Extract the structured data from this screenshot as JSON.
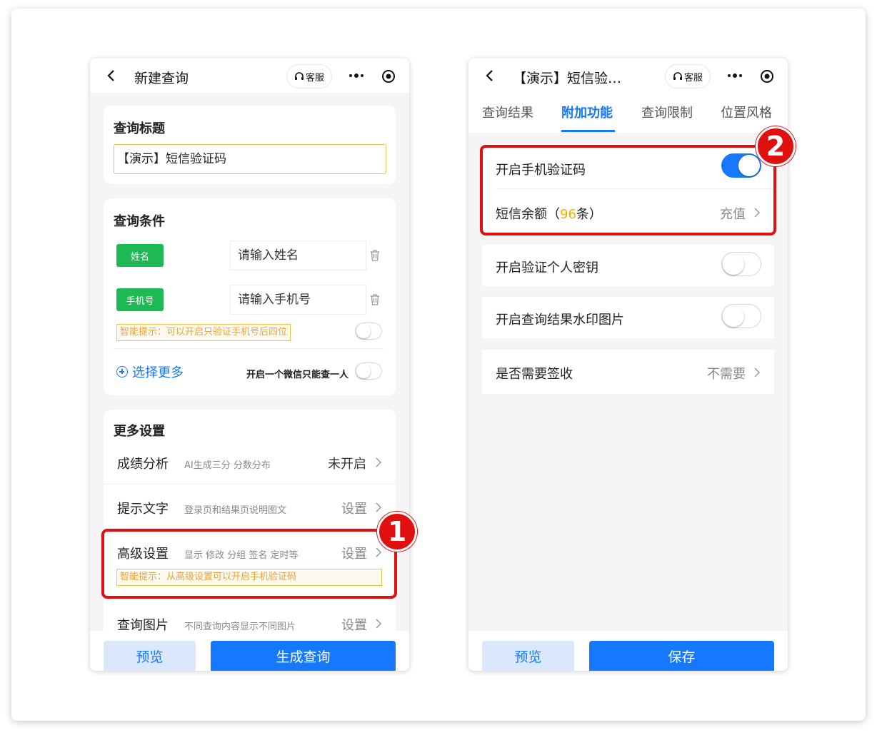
{
  "left": {
    "nav_title": "新建查询",
    "service_label": "客服",
    "title_section": {
      "heading": "查询标题",
      "value": "【演示】短信验证码"
    },
    "conditions": {
      "heading": "查询条件",
      "fields": [
        {
          "tag": "姓名",
          "placeholder": "请输入姓名"
        },
        {
          "tag": "手机号",
          "placeholder": "请输入手机号"
        }
      ],
      "hint": "智能提示：可以开启只验证手机号后四位",
      "select_more": "选择更多",
      "one_wechat_label": "开启一个微信只能查一人"
    },
    "more_settings": {
      "heading": "更多设置",
      "rows": [
        {
          "label": "成绩分析",
          "desc": "AI生成三分 分数分布",
          "value": "未开启"
        },
        {
          "label": "提示文字",
          "desc": "登录页和结果页说明图文",
          "value": "设置"
        },
        {
          "label": "高级设置",
          "desc": "显示 修改 分组 签名 定时等",
          "value": "设置"
        },
        {
          "label": "查询图片",
          "desc": "不同查询内容显示不同图片",
          "value": "设置"
        }
      ],
      "advanced_hint": "智能提示：从高级设置可以开启手机验证码"
    },
    "preview_label": "预览",
    "generate_label": "生成查询"
  },
  "right": {
    "nav_title": "【演示】短信验…",
    "service_label": "客服",
    "tabs": [
      "查询结果",
      "附加功能",
      "查询限制",
      "位置风格"
    ],
    "active_tab": "附加功能",
    "sms_toggle_label": "开启手机验证码",
    "sms_balance_prefix": "短信余额（",
    "sms_balance_amount": "96",
    "sms_balance_suffix": "条）",
    "recharge_label": "充值",
    "personal_key_label": "开启验证个人密钥",
    "watermark_label": "开启查询结果水印图片",
    "sign_label": "是否需要签收",
    "sign_value": "不需要",
    "preview_label": "预览",
    "save_label": "保存"
  },
  "badges": [
    "1",
    "2"
  ],
  "colors": {
    "accent": "#1677ff",
    "tag_green": "#1db954",
    "highlight": "#e01010",
    "hint": "#e8a23a",
    "amount": "#f2b100"
  }
}
